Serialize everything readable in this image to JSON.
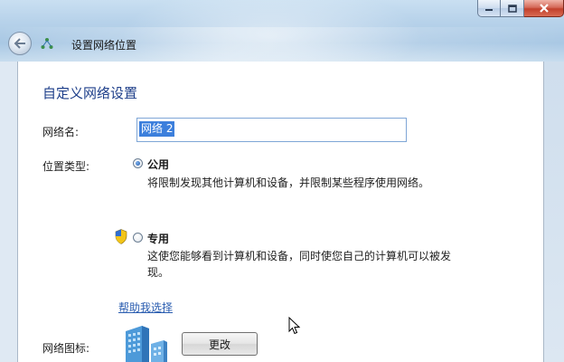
{
  "window": {
    "title": "设置网络位置",
    "controls": [
      "minimize-icon",
      "maximize-icon",
      "close-icon"
    ]
  },
  "main": {
    "heading": "自定义网络设置",
    "network_name_label": "网络名:",
    "network_name_value": "网络 2",
    "location_type_label": "位置类型:",
    "options": [
      {
        "title": "公用",
        "description": "将限制发现其他计算机和设备，并限制某些程序使用网络。",
        "checked": true
      },
      {
        "title": "专用",
        "description_line1": "这使您能够看到计算机和设备，同时使您自己的计算机可以被发",
        "description_line2": "现。",
        "checked": false
      }
    ],
    "help_link": "帮助我选择",
    "network_icon_label": "网络图标:",
    "change_button": "更改"
  },
  "colors": {
    "heading": "#1e3f8a",
    "link": "#2a5db0",
    "selection": "#3c7fdc",
    "titlebar": "#b7d2ea"
  }
}
